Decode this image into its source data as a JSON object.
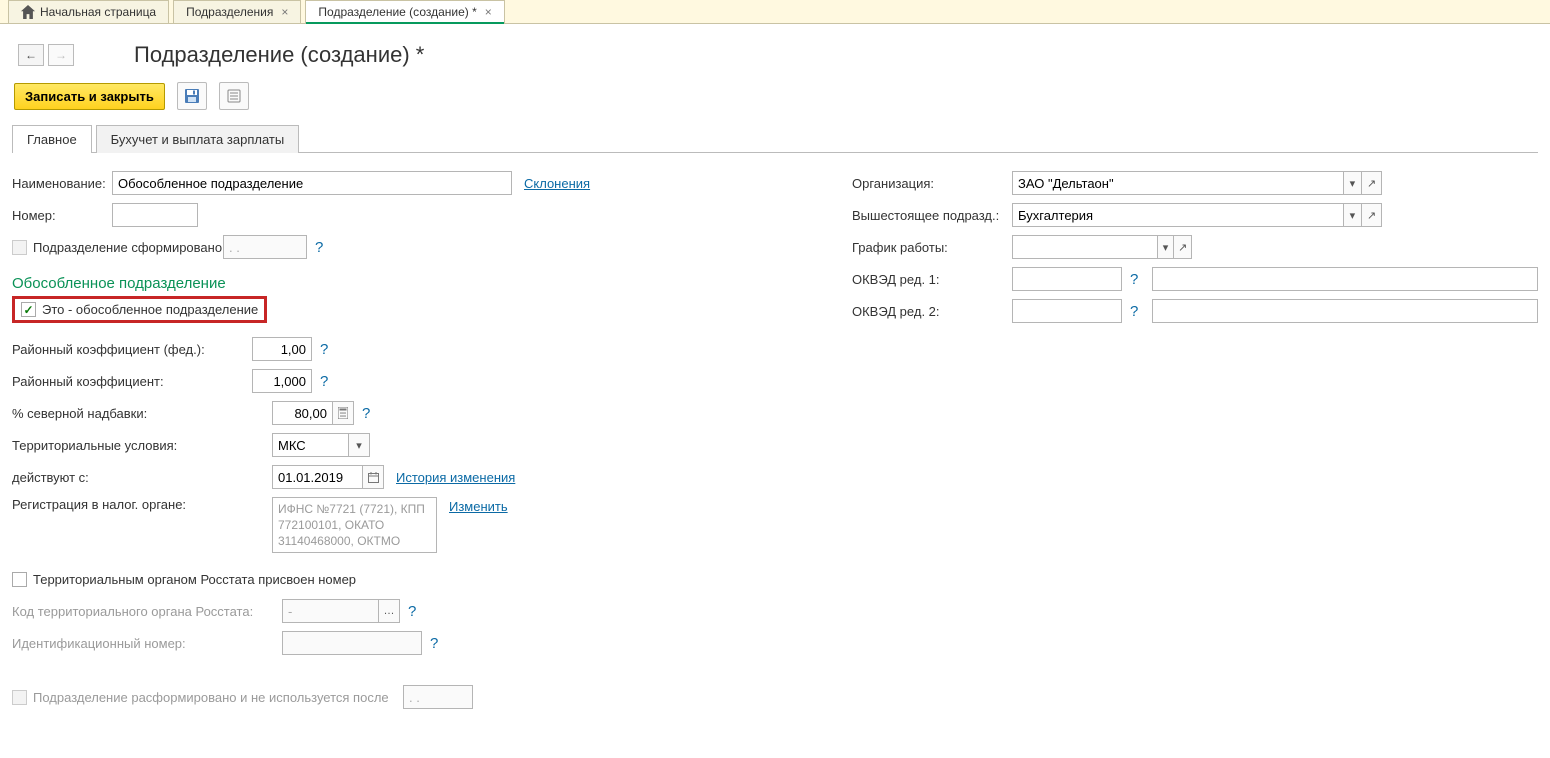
{
  "topTabs": {
    "home": "Начальная страница",
    "t1": "Подразделения",
    "t2": "Подразделение (создание) *"
  },
  "pageTitle": "Подразделение (создание) *",
  "toolbar": {
    "saveClose": "Записать и закрыть"
  },
  "formTabs": {
    "main": "Главное",
    "acc": "Бухучет и выплата зарплаты"
  },
  "left": {
    "name_lbl": "Наименование:",
    "name_val": "Обособленное подразделение",
    "declension": "Склонения",
    "number_lbl": "Номер:",
    "number_val": "",
    "formed_lbl": "Подразделение сформировано",
    "formed_date": ". .",
    "sect_title": "Обособленное подразделение",
    "is_sep_lbl": "Это - обособленное подразделение",
    "coef_fed_lbl": "Районный коэффициент (фед.):",
    "coef_fed_val": "1,00",
    "coef_lbl": "Районный коэффициент:",
    "coef_val": "1,000",
    "north_lbl": "% северной надбавки:",
    "north_val": "80,00",
    "terr_lbl": "Территориальные условия:",
    "terr_val": "МКС",
    "valid_lbl": "действуют с:",
    "valid_val": "01.01.2019",
    "history": "История изменения",
    "tax_lbl": "Регистрация в налог. органе:",
    "tax_val": "ИФНС №7721 (7721), КПП 772100101, ОКАТО 31140468000, ОКТМО",
    "change": "Изменить",
    "rosstat_lbl": "Территориальным органом Росстата присвоен номер",
    "rosstat_code_lbl": "Код территориального органа Росстата:",
    "rosstat_code_val": "-",
    "ident_lbl": "Идентификационный номер:",
    "ident_val": "",
    "disband_lbl": "Подразделение расформировано и не используется после",
    "disband_date": ". ."
  },
  "right": {
    "org_lbl": "Организация:",
    "org_val": "ЗАО \"Дельтаон\"",
    "parent_lbl": "Вышестоящее подразд.:",
    "parent_val": "Бухгалтерия",
    "sched_lbl": "График работы:",
    "sched_val": "",
    "okved1_lbl": "ОКВЭД ред. 1:",
    "okved1_val": "",
    "okved2_lbl": "ОКВЭД ред. 2:",
    "okved2_val": ""
  }
}
